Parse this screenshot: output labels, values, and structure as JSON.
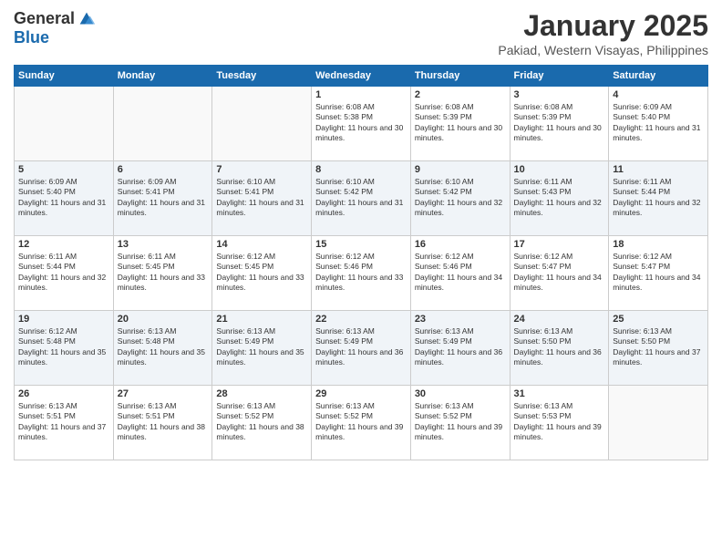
{
  "header": {
    "logo_general": "General",
    "logo_blue": "Blue",
    "month": "January 2025",
    "location": "Pakiad, Western Visayas, Philippines"
  },
  "weekdays": [
    "Sunday",
    "Monday",
    "Tuesday",
    "Wednesday",
    "Thursday",
    "Friday",
    "Saturday"
  ],
  "weeks": [
    [
      {
        "day": "",
        "sunrise": "",
        "sunset": "",
        "daylight": ""
      },
      {
        "day": "",
        "sunrise": "",
        "sunset": "",
        "daylight": ""
      },
      {
        "day": "",
        "sunrise": "",
        "sunset": "",
        "daylight": ""
      },
      {
        "day": "1",
        "sunrise": "6:08 AM",
        "sunset": "5:38 PM",
        "daylight": "11 hours and 30 minutes."
      },
      {
        "day": "2",
        "sunrise": "6:08 AM",
        "sunset": "5:39 PM",
        "daylight": "11 hours and 30 minutes."
      },
      {
        "day": "3",
        "sunrise": "6:08 AM",
        "sunset": "5:39 PM",
        "daylight": "11 hours and 30 minutes."
      },
      {
        "day": "4",
        "sunrise": "6:09 AM",
        "sunset": "5:40 PM",
        "daylight": "11 hours and 31 minutes."
      }
    ],
    [
      {
        "day": "5",
        "sunrise": "6:09 AM",
        "sunset": "5:40 PM",
        "daylight": "11 hours and 31 minutes."
      },
      {
        "day": "6",
        "sunrise": "6:09 AM",
        "sunset": "5:41 PM",
        "daylight": "11 hours and 31 minutes."
      },
      {
        "day": "7",
        "sunrise": "6:10 AM",
        "sunset": "5:41 PM",
        "daylight": "11 hours and 31 minutes."
      },
      {
        "day": "8",
        "sunrise": "6:10 AM",
        "sunset": "5:42 PM",
        "daylight": "11 hours and 31 minutes."
      },
      {
        "day": "9",
        "sunrise": "6:10 AM",
        "sunset": "5:42 PM",
        "daylight": "11 hours and 32 minutes."
      },
      {
        "day": "10",
        "sunrise": "6:11 AM",
        "sunset": "5:43 PM",
        "daylight": "11 hours and 32 minutes."
      },
      {
        "day": "11",
        "sunrise": "6:11 AM",
        "sunset": "5:44 PM",
        "daylight": "11 hours and 32 minutes."
      }
    ],
    [
      {
        "day": "12",
        "sunrise": "6:11 AM",
        "sunset": "5:44 PM",
        "daylight": "11 hours and 32 minutes."
      },
      {
        "day": "13",
        "sunrise": "6:11 AM",
        "sunset": "5:45 PM",
        "daylight": "11 hours and 33 minutes."
      },
      {
        "day": "14",
        "sunrise": "6:12 AM",
        "sunset": "5:45 PM",
        "daylight": "11 hours and 33 minutes."
      },
      {
        "day": "15",
        "sunrise": "6:12 AM",
        "sunset": "5:46 PM",
        "daylight": "11 hours and 33 minutes."
      },
      {
        "day": "16",
        "sunrise": "6:12 AM",
        "sunset": "5:46 PM",
        "daylight": "11 hours and 34 minutes."
      },
      {
        "day": "17",
        "sunrise": "6:12 AM",
        "sunset": "5:47 PM",
        "daylight": "11 hours and 34 minutes."
      },
      {
        "day": "18",
        "sunrise": "6:12 AM",
        "sunset": "5:47 PM",
        "daylight": "11 hours and 34 minutes."
      }
    ],
    [
      {
        "day": "19",
        "sunrise": "6:12 AM",
        "sunset": "5:48 PM",
        "daylight": "11 hours and 35 minutes."
      },
      {
        "day": "20",
        "sunrise": "6:13 AM",
        "sunset": "5:48 PM",
        "daylight": "11 hours and 35 minutes."
      },
      {
        "day": "21",
        "sunrise": "6:13 AM",
        "sunset": "5:49 PM",
        "daylight": "11 hours and 35 minutes."
      },
      {
        "day": "22",
        "sunrise": "6:13 AM",
        "sunset": "5:49 PM",
        "daylight": "11 hours and 36 minutes."
      },
      {
        "day": "23",
        "sunrise": "6:13 AM",
        "sunset": "5:49 PM",
        "daylight": "11 hours and 36 minutes."
      },
      {
        "day": "24",
        "sunrise": "6:13 AM",
        "sunset": "5:50 PM",
        "daylight": "11 hours and 36 minutes."
      },
      {
        "day": "25",
        "sunrise": "6:13 AM",
        "sunset": "5:50 PM",
        "daylight": "11 hours and 37 minutes."
      }
    ],
    [
      {
        "day": "26",
        "sunrise": "6:13 AM",
        "sunset": "5:51 PM",
        "daylight": "11 hours and 37 minutes."
      },
      {
        "day": "27",
        "sunrise": "6:13 AM",
        "sunset": "5:51 PM",
        "daylight": "11 hours and 38 minutes."
      },
      {
        "day": "28",
        "sunrise": "6:13 AM",
        "sunset": "5:52 PM",
        "daylight": "11 hours and 38 minutes."
      },
      {
        "day": "29",
        "sunrise": "6:13 AM",
        "sunset": "5:52 PM",
        "daylight": "11 hours and 39 minutes."
      },
      {
        "day": "30",
        "sunrise": "6:13 AM",
        "sunset": "5:52 PM",
        "daylight": "11 hours and 39 minutes."
      },
      {
        "day": "31",
        "sunrise": "6:13 AM",
        "sunset": "5:53 PM",
        "daylight": "11 hours and 39 minutes."
      },
      {
        "day": "",
        "sunrise": "",
        "sunset": "",
        "daylight": ""
      }
    ]
  ]
}
